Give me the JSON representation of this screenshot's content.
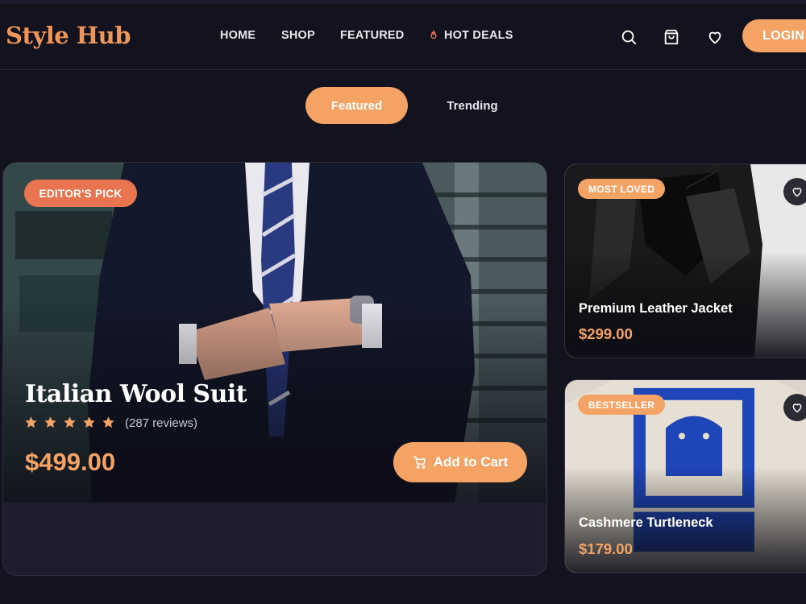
{
  "brand": {
    "name": "Style Hub",
    "accent": "#f5a365"
  },
  "nav": {
    "home": "HOME",
    "shop": "SHOP",
    "featured": "FEATURED",
    "deals": "HOT DEALS",
    "deals_icon": "flame-icon"
  },
  "header_icons": [
    "search-icon",
    "shopping-bag-icon",
    "heart-icon"
  ],
  "login_label": "LOGIN",
  "tabs": {
    "featured": "Featured",
    "trending": "Trending",
    "active": "Featured"
  },
  "hero": {
    "badge": "EDITOR'S PICK",
    "title": "Italian Wool Suit",
    "rating": 5,
    "reviews": "(287 reviews)",
    "price": "$499.00",
    "cart_label": "Add to Cart"
  },
  "products": [
    {
      "badge": "MOST LOVED",
      "title": "Premium Leather Jacket",
      "price": "$299.00"
    },
    {
      "badge": "BESTSELLER",
      "title": "Cashmere Turtleneck",
      "price": "$179.00"
    }
  ]
}
